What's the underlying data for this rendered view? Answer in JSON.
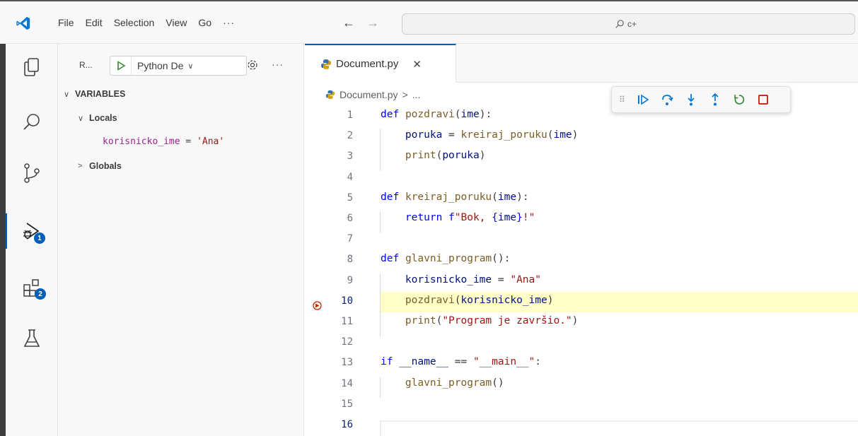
{
  "titlebar": {
    "menu": [
      "File",
      "Edit",
      "Selection",
      "View",
      "Go"
    ],
    "more": "···",
    "search_text": "c+"
  },
  "activity": {
    "icons": [
      "explorer-icon",
      "search-icon",
      "source-control-icon",
      "run-debug-icon",
      "extensions-icon",
      "testing-icon"
    ],
    "debug_badge": "1",
    "extensions_badge": "2",
    "accent": "#005fb8"
  },
  "sidebar": {
    "title": "R...",
    "launch_config": "Python De",
    "more": "···",
    "variables_header": "VARIABLES",
    "locals_label": "Locals",
    "locals": [
      {
        "name": "korisnicko_ime",
        "eq": " = ",
        "value": "'Ana'"
      }
    ],
    "globals_label": "Globals"
  },
  "editor": {
    "tab_label": "Document.py",
    "breadcrumb_file": "Document.py",
    "breadcrumb_sep": ">",
    "breadcrumb_more": "...",
    "current_line": 10,
    "highlight_color": "#ffffc7"
  },
  "code_lines": [
    {
      "n": "1"
    },
    {
      "n": "2"
    },
    {
      "n": "3"
    },
    {
      "n": "4"
    },
    {
      "n": "5"
    },
    {
      "n": "6"
    },
    {
      "n": "7"
    },
    {
      "n": "8"
    },
    {
      "n": "9"
    },
    {
      "n": "10"
    },
    {
      "n": "11"
    },
    {
      "n": "12"
    },
    {
      "n": "13"
    },
    {
      "n": "14"
    },
    {
      "n": "15"
    },
    {
      "n": "16"
    }
  ],
  "code": {
    "l1": {
      "kw": "def",
      "fn": "pozdravi",
      "open": "(",
      "param": "ime",
      "close": "):"
    },
    "l2": {
      "var": "poruka",
      "eq": " = ",
      "fn": "kreiraj_poruku",
      "open": "(",
      "arg": "ime",
      "close": ")"
    },
    "l3": {
      "fn": "print",
      "open": "(",
      "arg": "poruka",
      "close": ")"
    },
    "l5": {
      "kw": "def",
      "fn": "kreiraj_poruku",
      "open": "(",
      "param": "ime",
      "close": "):"
    },
    "l6": {
      "kw": "return",
      "fx": "f",
      "s1": "\"Bok, ",
      "b1": "{",
      "arg": "ime",
      "b2": "}",
      "s2": "!\""
    },
    "l8": {
      "kw": "def",
      "fn": "glavni_program",
      "close": "():"
    },
    "l9": {
      "var": "korisnicko_ime",
      "eq": " = ",
      "str": "\"Ana\""
    },
    "l10": {
      "fn": "pozdravi",
      "open": "(",
      "arg": "korisnicko_ime",
      "close": ")"
    },
    "l11": {
      "fn": "print",
      "open": "(",
      "str": "\"Program je završio.\"",
      "close": ")"
    },
    "l13": {
      "kw": "if",
      "var": "__name__",
      "eq": " == ",
      "str": "\"__main__\"",
      "close": ":"
    },
    "l14": {
      "fn": "glavni_program",
      "close": "()"
    }
  }
}
